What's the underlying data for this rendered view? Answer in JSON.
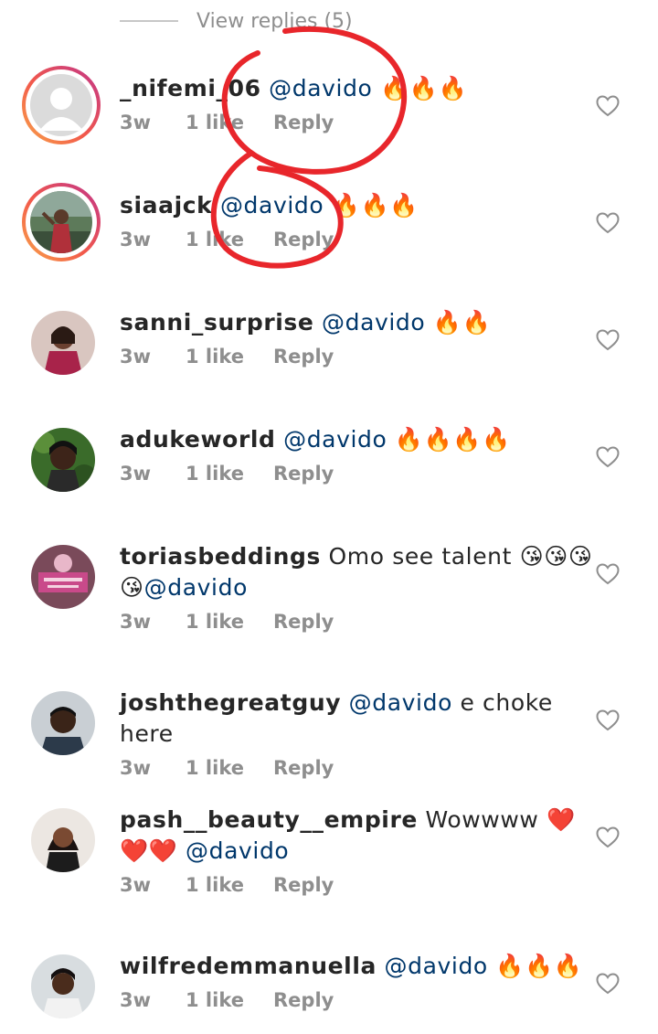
{
  "view_replies": {
    "label": "View replies (5)"
  },
  "comments": [
    {
      "user": "_nifemi_06",
      "text_before": "",
      "mention": "@davido",
      "text_after": " 🔥🔥🔥",
      "time": "3w",
      "likes": "1 like",
      "reply": "Reply",
      "story_ring": true
    },
    {
      "user": "siaajck",
      "text_before": "",
      "mention": "@davido",
      "text_after": " 🔥🔥🔥",
      "time": "3w",
      "likes": "1 like",
      "reply": "Reply",
      "story_ring": true
    },
    {
      "user": "sanni_surprise",
      "text_before": "",
      "mention": "@davido",
      "text_after": " 🔥🔥",
      "time": "3w",
      "likes": "1 like",
      "reply": "Reply",
      "story_ring": false
    },
    {
      "user": "adukeworld",
      "text_before": "",
      "mention": "@davido",
      "text_after": " 🔥🔥🔥🔥",
      "time": "3w",
      "likes": "1 like",
      "reply": "Reply",
      "story_ring": false
    },
    {
      "user": "toriasbeddings",
      "text_before": " Omo see talent 😘😘😘😘",
      "mention": "@davido",
      "text_after": "",
      "time": "3w",
      "likes": "1 like",
      "reply": "Reply",
      "story_ring": false
    },
    {
      "user": "joshthegreatguy",
      "text_before": "",
      "mention": "@davido",
      "text_after": " e choke here",
      "time": "3w",
      "likes": "1 like",
      "reply": "Reply",
      "story_ring": false
    },
    {
      "user": "pash__beauty__empire",
      "text_before": " Wowwww ❤️❤️❤️ ",
      "mention": "@davido",
      "text_after": "",
      "time": "3w",
      "likes": "1 like",
      "reply": "Reply",
      "story_ring": false
    },
    {
      "user": "wilfredemmanuella",
      "text_before": "",
      "mention": "@davido",
      "text_after": " 🔥🔥🔥",
      "time": "3w",
      "likes": "1 like",
      "reply": "Reply",
      "story_ring": false
    }
  ],
  "colors": {
    "mention": "#00376b",
    "meta": "#8e8e8e",
    "annotation": "#e8262b"
  },
  "icons": {
    "like": "heart-outline-icon",
    "avatar_placeholder": "person-placeholder-icon"
  }
}
